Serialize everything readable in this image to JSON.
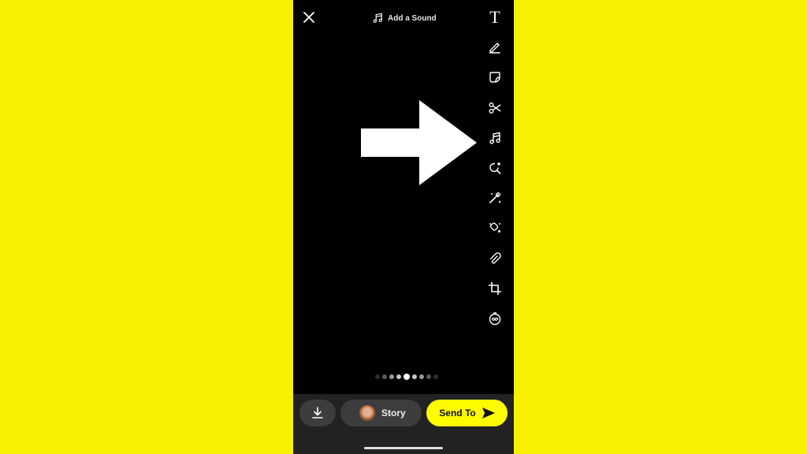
{
  "colors": {
    "background": "#f7f100",
    "phone": "#000000",
    "bottom_bar": "#222222",
    "send_button": "#fffc00"
  },
  "topbar": {
    "close_icon": "close-icon",
    "add_sound_label": "Add a Sound",
    "sound_icon": "music-note-icon"
  },
  "toolbar": {
    "items": [
      {
        "name": "text-tool",
        "icon": "text-icon",
        "glyph": "T"
      },
      {
        "name": "draw-tool",
        "icon": "pencil-icon"
      },
      {
        "name": "sticker-tool",
        "icon": "sticker-icon"
      },
      {
        "name": "scissors-tool",
        "icon": "scissors-icon"
      },
      {
        "name": "music-tool",
        "icon": "music-note-icon"
      },
      {
        "name": "lens-tool",
        "icon": "lens-search-icon"
      },
      {
        "name": "magic-tool",
        "icon": "magic-wand-icon"
      },
      {
        "name": "eraser-tool",
        "icon": "magic-eraser-icon"
      },
      {
        "name": "attach-tool",
        "icon": "paperclip-icon"
      },
      {
        "name": "crop-tool",
        "icon": "crop-icon"
      },
      {
        "name": "timer-tool",
        "icon": "infinity-timer-icon"
      }
    ]
  },
  "overlay": {
    "arrow_icon": "right-arrow-icon"
  },
  "filter_dots": {
    "count": 9,
    "active_index": 4
  },
  "bottom": {
    "save_icon": "download-icon",
    "story_label": "Story",
    "send_label": "Send To",
    "send_icon": "send-arrow-icon"
  }
}
